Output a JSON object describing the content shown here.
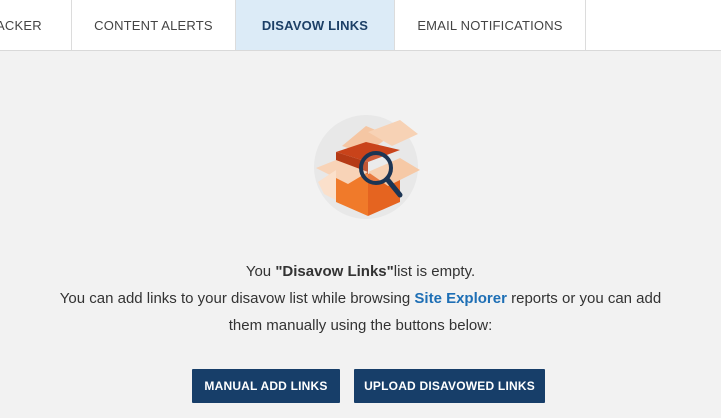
{
  "tabs": [
    {
      "label": "ACKER",
      "active": false
    },
    {
      "label": "CONTENT ALERTS",
      "active": false
    },
    {
      "label": "DISAVOW LINKS",
      "active": true
    },
    {
      "label": "EMAIL NOTIFICATIONS",
      "active": false
    }
  ],
  "empty_state": {
    "illustration_icon": "open-box-magnifier-icon",
    "line1_prefix": "You ",
    "line1_emphasis": "\"Disavow Links\"",
    "line1_suffix": "list is empty.",
    "line2_prefix": "You can add links to your disavow list while browsing ",
    "line2_link": "Site Explorer",
    "line2_suffix": " reports or you can add",
    "line3": "them manually using the buttons below:"
  },
  "buttons": {
    "manual_add": "MANUAL ADD LINKS",
    "upload": "UPLOAD DISAVOWED LINKS"
  },
  "colors": {
    "active_tab_bg": "#dcebf7",
    "button_bg": "#173e69",
    "link": "#1e6fb5",
    "box_orange": "#f07a2a"
  }
}
